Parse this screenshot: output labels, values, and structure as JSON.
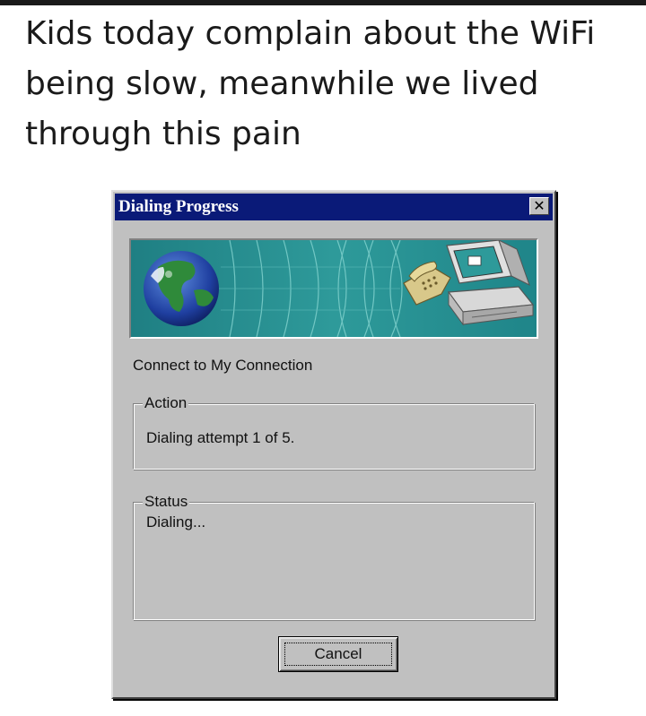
{
  "caption": {
    "line1": "Kids today complain about the WiFi",
    "line2": "being slow, meanwhile we lived",
    "line3": "through this pain"
  },
  "dialog": {
    "title": "Dialing Progress",
    "close_glyph": "✕",
    "connection_label": "Connect to My Connection",
    "action": {
      "legend": "Action",
      "text": "Dialing attempt 1 of 5."
    },
    "status": {
      "legend": "Status",
      "text": "Dialing..."
    },
    "cancel_label": "Cancel"
  },
  "banner": {
    "icons": [
      "globe-icon",
      "telephone-icon",
      "computer-icon"
    ]
  },
  "colors": {
    "titlebar": "#0a1a78",
    "dialog_face": "#c0c0c0",
    "banner_teal": "#2a8f91"
  }
}
